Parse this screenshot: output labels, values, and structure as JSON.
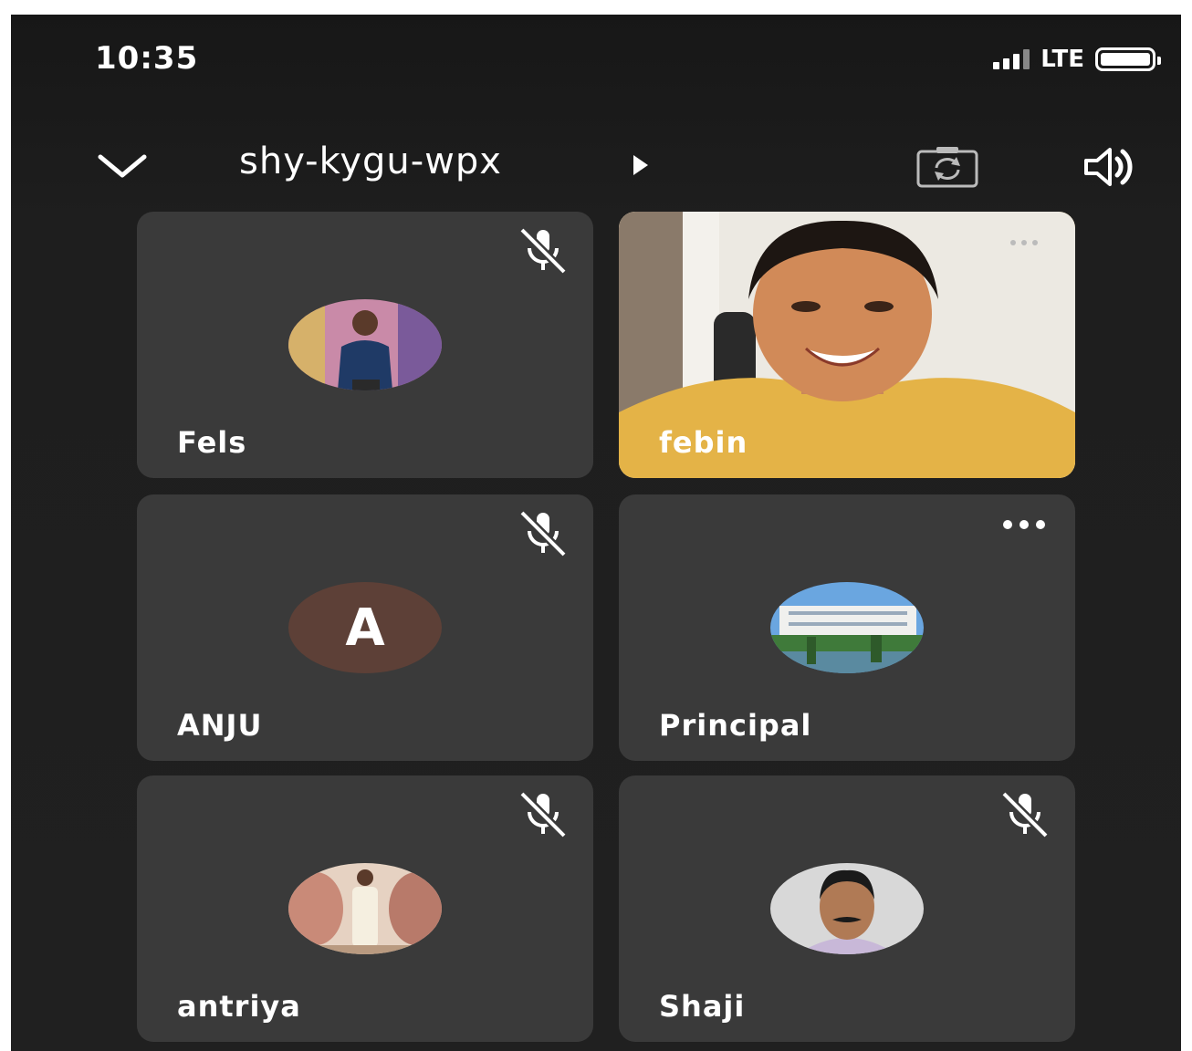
{
  "status_bar": {
    "time": "10:35",
    "network": "LTE"
  },
  "meeting": {
    "code": "shy-kygu-wpx"
  },
  "icons": {
    "collapse": "chevron-down-icon",
    "info": "play-arrow-icon",
    "switch_camera": "switch-camera-icon",
    "speaker": "speaker-icon",
    "muted": "mic-off-icon",
    "more": "more-options-icon"
  },
  "colors": {
    "background": "#1f1f1f",
    "tile": "#3a3a3a",
    "anju_avatar": "#5d4037",
    "text": "#ffffff"
  },
  "participants": [
    {
      "name": "Fels",
      "muted": true,
      "avatar": "photo"
    },
    {
      "name": "febin",
      "muted": false,
      "video": true
    },
    {
      "name": "ANJU",
      "muted": true,
      "avatar_letter": "A"
    },
    {
      "name": "Principal",
      "muted": false,
      "avatar": "photo",
      "more_options": true
    },
    {
      "name": "antriya",
      "muted": true,
      "avatar": "photo"
    },
    {
      "name": "Shaji",
      "muted": true,
      "avatar": "photo"
    }
  ]
}
